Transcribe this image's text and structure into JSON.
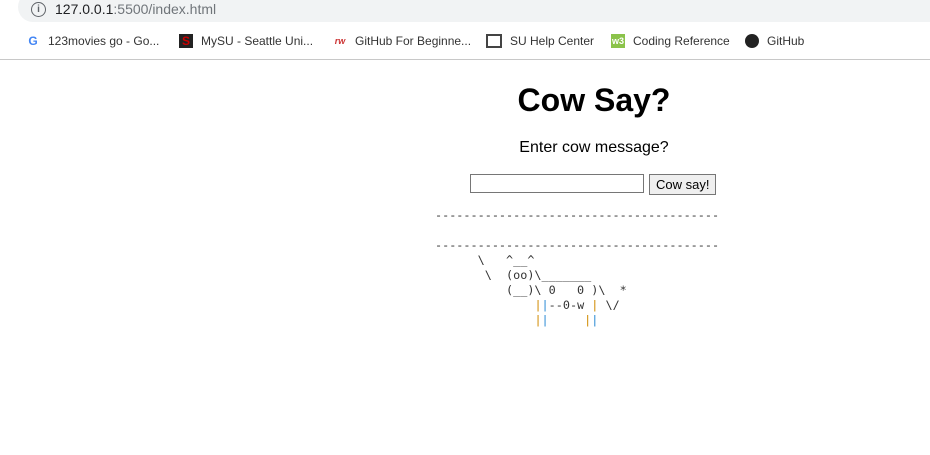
{
  "browser": {
    "url_host": "127.0.0.1",
    "url_rest": ":5500/index.html",
    "bookmarks": [
      {
        "label": "123movies go - Go...",
        "icon": "google-icon"
      },
      {
        "label": "MySU - Seattle Uni...",
        "icon": "seattle-u-icon"
      },
      {
        "label": "GitHub For Beginne...",
        "icon": "rw-icon"
      },
      {
        "label": "SU Help Center",
        "icon": "book-icon"
      },
      {
        "label": "Coding Reference",
        "icon": "w3-icon"
      },
      {
        "label": "GitHub",
        "icon": "github-icon"
      }
    ]
  },
  "page": {
    "title": "Cow Say?",
    "prompt": "Enter cow message?",
    "input_value": "",
    "button_label": "Cow say!",
    "output": {
      "top_border": "----------------------------------------",
      "message": "",
      "bottom_border": "----------------------------------------",
      "cow": [
        "      \\   ^__^",
        "       \\  (oo)\\_______",
        "          (__)\\ 0   0 )\\  *",
        "              ||--0-w | \\/",
        "              ||     ||"
      ]
    }
  }
}
